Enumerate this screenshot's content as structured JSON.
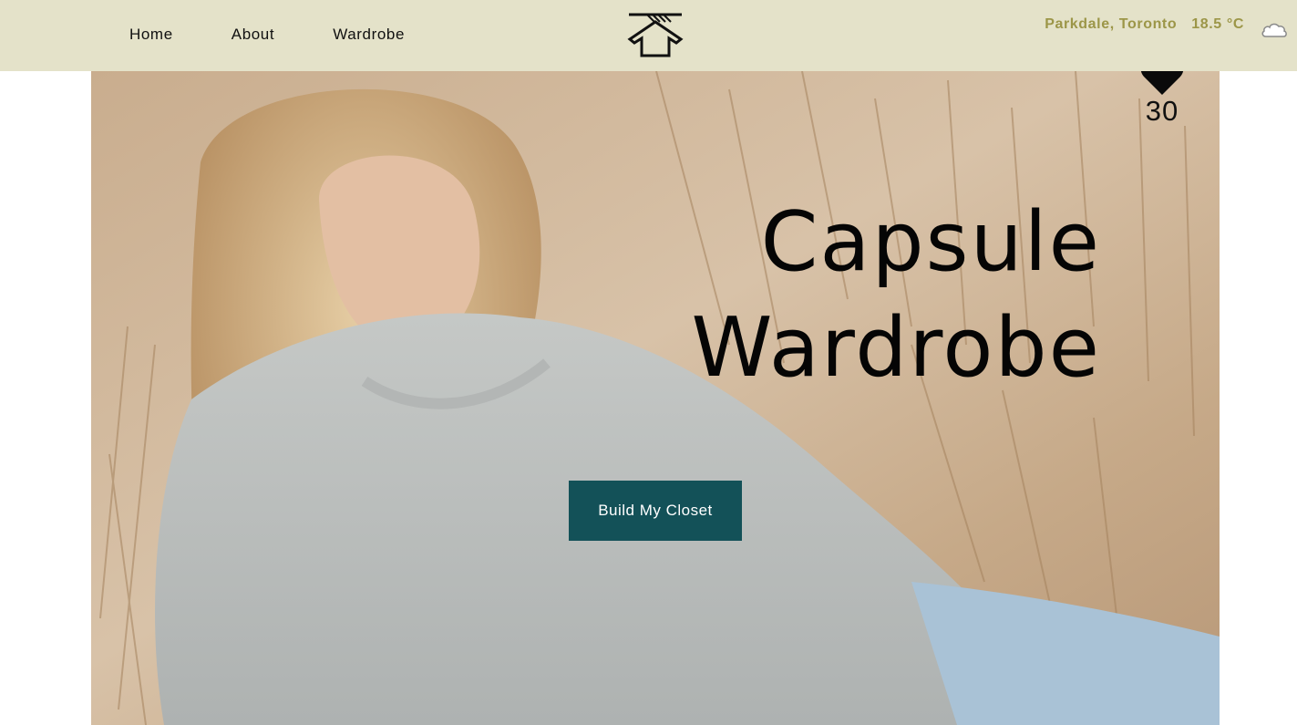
{
  "nav": {
    "items": [
      {
        "label": "Home"
      },
      {
        "label": "About"
      },
      {
        "label": "Wardrobe"
      }
    ]
  },
  "header": {
    "logo_icon": "hanger-shirt-icon",
    "location": "Parkdale, Toronto",
    "temperature": "18.5 °C",
    "weather_icon": "cloud-icon",
    "accent_color": "#9c9648",
    "nav_background": "#e4e2c9"
  },
  "favorites": {
    "icon": "heart-icon",
    "count": "30"
  },
  "hero": {
    "title_line1": "Capsule",
    "title_line2": "Wardrobe",
    "cta_label": "Build My Closet",
    "cta_color": "#135158"
  }
}
